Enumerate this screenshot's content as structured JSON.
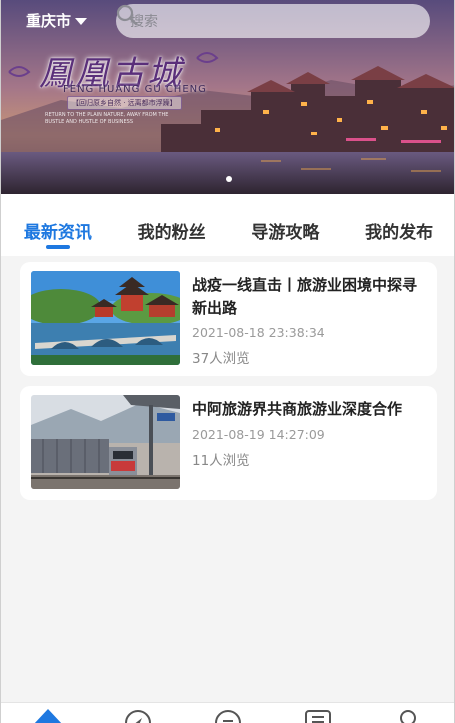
{
  "header": {
    "city": "重庆市",
    "search_placeholder": "搜索"
  },
  "banner": {
    "title": "鳳凰古城",
    "pinyin": "FENG HUANG GU CHENG",
    "slogan": "【回归原乡自然 · 远离都市浮躁】",
    "small_text": "RETURN TO THE PLAIN NATURE, AWAY FROM THE BUSTLE AND HUSTLE OF BUSINESS",
    "slide_count": 3,
    "active_slide": 1
  },
  "tabs": [
    {
      "label": "最新资讯",
      "active": true
    },
    {
      "label": "我的粉丝",
      "active": false
    },
    {
      "label": "导游攻略",
      "active": false
    },
    {
      "label": "我的发布",
      "active": false
    }
  ],
  "articles": [
    {
      "title": "战疫一线直击丨旅游业困境中探寻新出路",
      "date": "2021-08-18 23:38:34",
      "views": "37人浏览",
      "image": "chinese-pavilion-bridge-photo"
    },
    {
      "title": "中阿旅游界共商旅游业深度合作",
      "date": "2021-08-19 14:27:09",
      "views": "11人浏览",
      "image": "train-station-photo"
    }
  ],
  "bottom_nav": [
    "home-icon",
    "compass-icon",
    "message-icon",
    "list-icon",
    "user-icon"
  ],
  "colors": {
    "accent": "#1e78e0",
    "background": "#f4f4f4",
    "card": "#ffffff"
  }
}
